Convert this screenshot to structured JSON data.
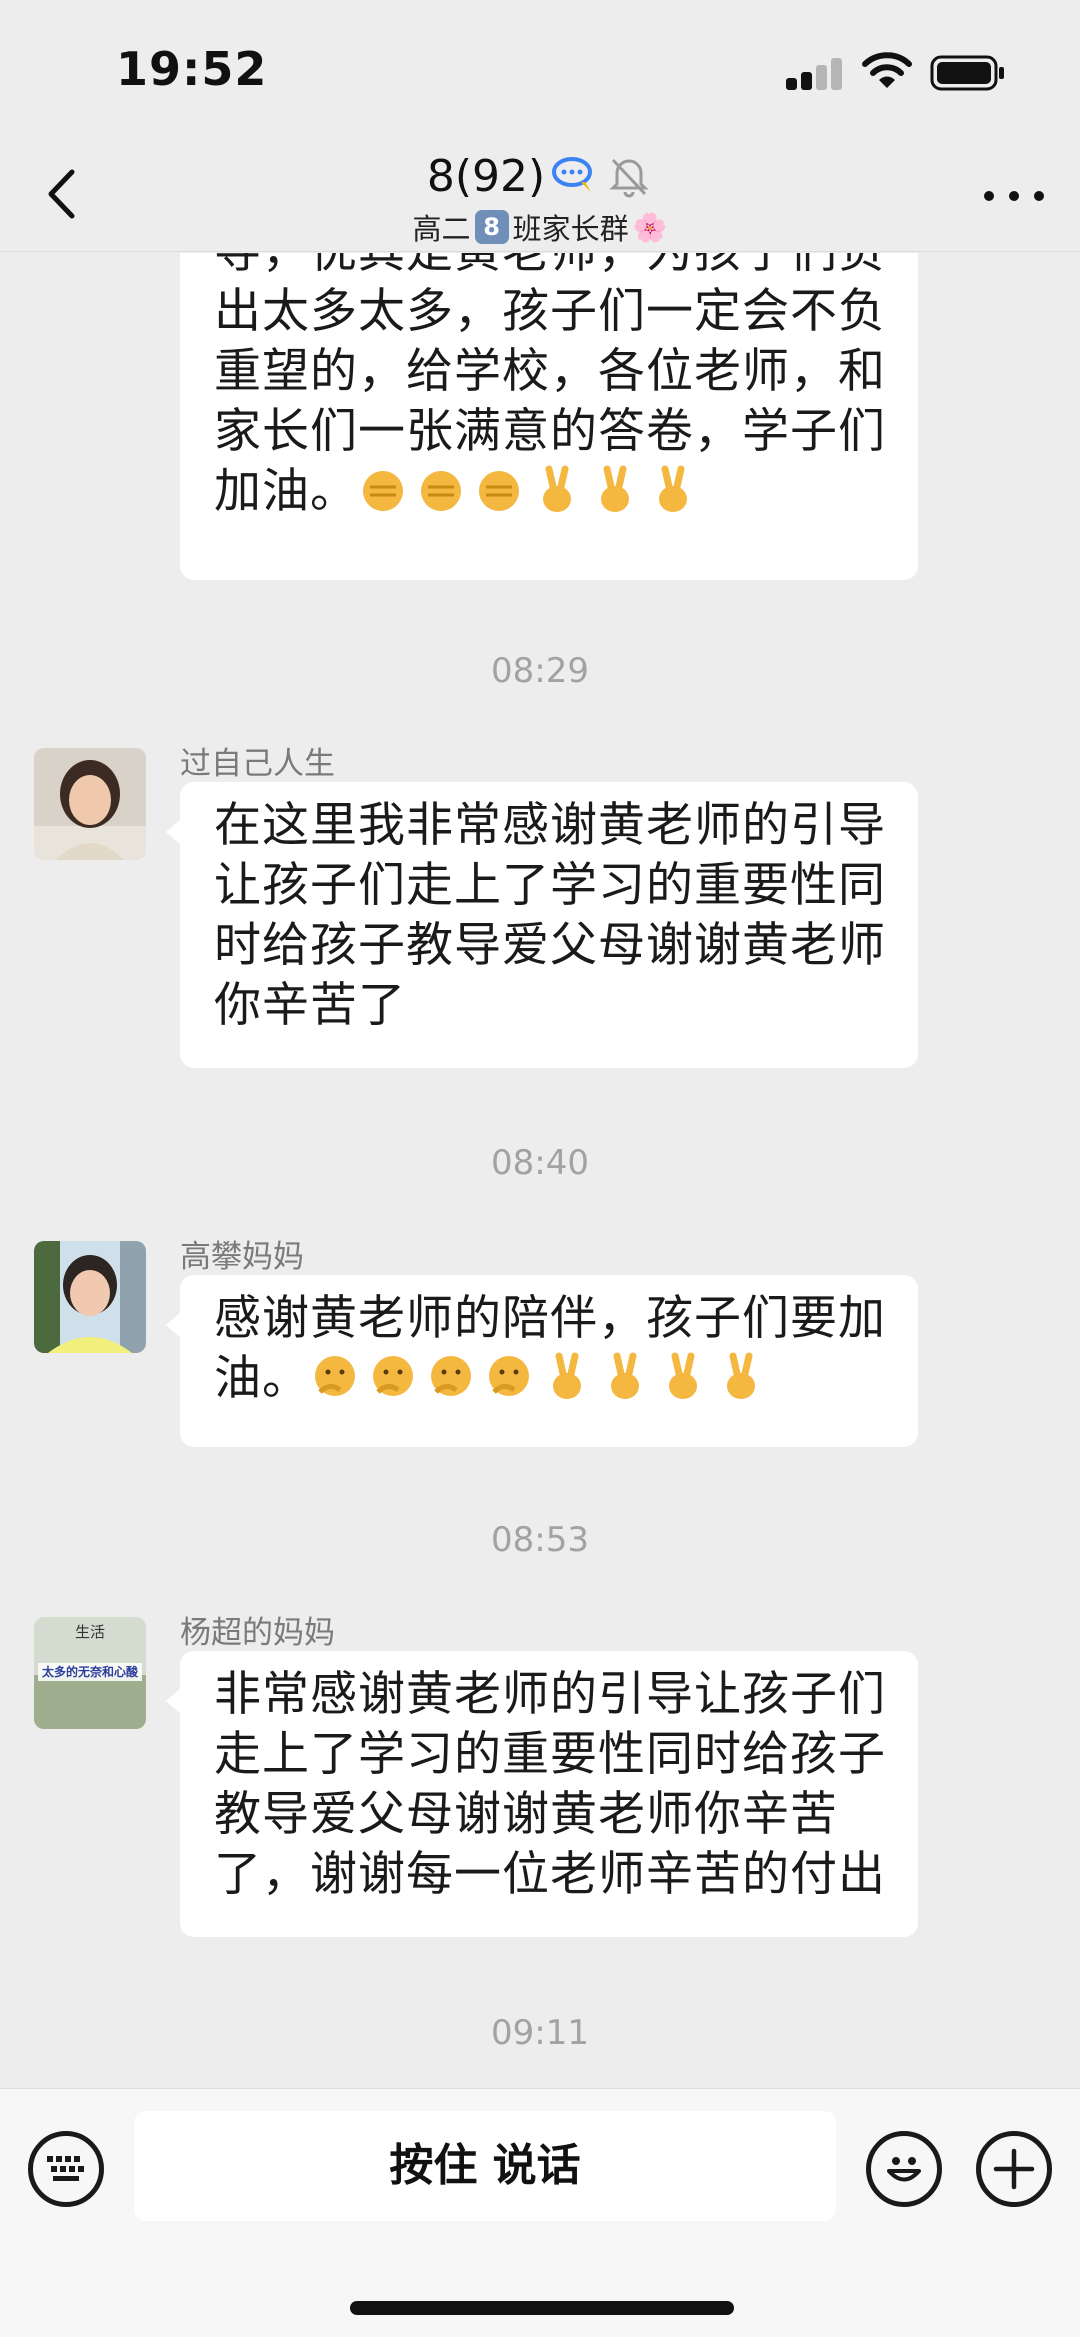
{
  "status_bar": {
    "time": "19:52"
  },
  "nav": {
    "title": "8(92)",
    "subtitle_prefix": "高二",
    "subtitle_badge": "8",
    "subtitle_suffix": "班家长群",
    "subtitle_flower": "🌸"
  },
  "messages": [
    {
      "type": "text",
      "text": "导，优其是黄老师，为孩子们负出太多太多，孩子们一定会不负重望的，给学校，各位老师，和家长们一张满意的答卷，学子们加油。",
      "emojis": [
        "fist",
        "fist",
        "fist",
        "victory",
        "victory",
        "victory"
      ]
    },
    {
      "type": "time",
      "text": "08:29"
    },
    {
      "type": "text",
      "sender": "过自己人生",
      "avatar": "woman-avatar",
      "text": " 在这里我非常感谢黄老师的引导让孩子们走上了学习的重要性同时给孩子教导爱父母谢谢黄老师你辛苦了"
    },
    {
      "type": "time",
      "text": "08:40"
    },
    {
      "type": "text",
      "sender": "高攀妈妈",
      "avatar": "woman-avatar-2",
      "text": "感谢黄老师的陪伴，孩子们要加油。",
      "emojis": [
        "thinking",
        "thinking",
        "thinking",
        "thinking",
        "victory",
        "victory",
        "victory",
        "victory"
      ]
    },
    {
      "type": "time",
      "text": "08:53"
    },
    {
      "type": "text",
      "sender": "杨超的妈妈",
      "avatar": "poster-avatar",
      "avatar_text_top": "生活",
      "avatar_text_bottom": "太多的无奈和心酸",
      "text": " 非常感谢黄老师的引导让孩子们走上了学习的重要性同时给孩子教导爱父母谢谢黄老师你辛苦了，谢谢每一位老师辛苦的付出"
    },
    {
      "type": "time",
      "text": "09:11"
    }
  ],
  "input_bar": {
    "voice_label": "按住 说话"
  }
}
